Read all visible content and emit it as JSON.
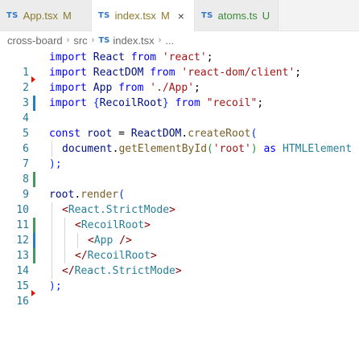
{
  "tabs": [
    {
      "icon": "TS",
      "name": "App.tsx",
      "badge": "M",
      "active": false
    },
    {
      "icon": "TS",
      "name": "index.tsx",
      "badge": "M",
      "active": true,
      "close": "×"
    },
    {
      "icon": "TS",
      "name": "atoms.ts",
      "badge": "U",
      "active": false
    }
  ],
  "breadcrumb": {
    "items": [
      "cross-board",
      "src"
    ],
    "file_icon": "TS",
    "file": "index.tsx",
    "trail": "...",
    "separator": "›"
  },
  "line_numbers": [
    "1",
    "2",
    "3",
    "4",
    "5",
    "6",
    "7",
    "8",
    "9",
    "10",
    "11",
    "12",
    "13",
    "14",
    "15",
    "16"
  ],
  "code": {
    "l1": {
      "kw": "import",
      "id": "React",
      "from": "from",
      "str": "'react'",
      "end": ";"
    },
    "l2": {
      "kw": "import",
      "id": "ReactDOM",
      "from": "from",
      "str": "'react-dom/client'",
      "end": ";"
    },
    "l3": {
      "kw": "import",
      "id": "App",
      "from": "from",
      "str": "'./App'",
      "end": ";"
    },
    "l4": {
      "kw": "import",
      "open": "{",
      "id": "RecoilRoot",
      "close": "}",
      "from": "from",
      "str": "\"recoil\"",
      "end": ";"
    },
    "l6": {
      "kw": "const",
      "id": "root",
      "eq": "=",
      "obj": "ReactDOM",
      "dot": ".",
      "fn": "createRoot",
      "paren": "("
    },
    "l7": {
      "obj": "document",
      "dot": ".",
      "fn": "getElementById",
      "open": "(",
      "str": "'root'",
      "close": ")",
      "as": "as",
      "cls": "HTMLElement"
    },
    "l8": {
      "text": ");"
    },
    "l10": {
      "obj": "root",
      "dot": ".",
      "fn": "render",
      "paren": "("
    },
    "l11": {
      "lt": "<",
      "tag": "React.StrictMode",
      "gt": ">"
    },
    "l12": {
      "lt": "<",
      "tag": "RecoilRoot",
      "gt": ">"
    },
    "l13": {
      "lt": "<",
      "tag": "App",
      "gt": " />"
    },
    "l14": {
      "lt": "</",
      "tag": "RecoilRoot",
      "gt": ">"
    },
    "l15": {
      "lt": "</",
      "tag": "React.StrictMode",
      "gt": ">"
    },
    "l16": {
      "text": ");"
    }
  },
  "colors": {
    "keyword": "#0000ff",
    "string": "#a31515",
    "identifier": "#001080",
    "function": "#795e26",
    "type": "#267f99",
    "tag": "#800000",
    "line_number": "#237893",
    "git_added": "#48985d",
    "git_modified": "#2a7dbd",
    "git_deleted": "#e51400"
  }
}
